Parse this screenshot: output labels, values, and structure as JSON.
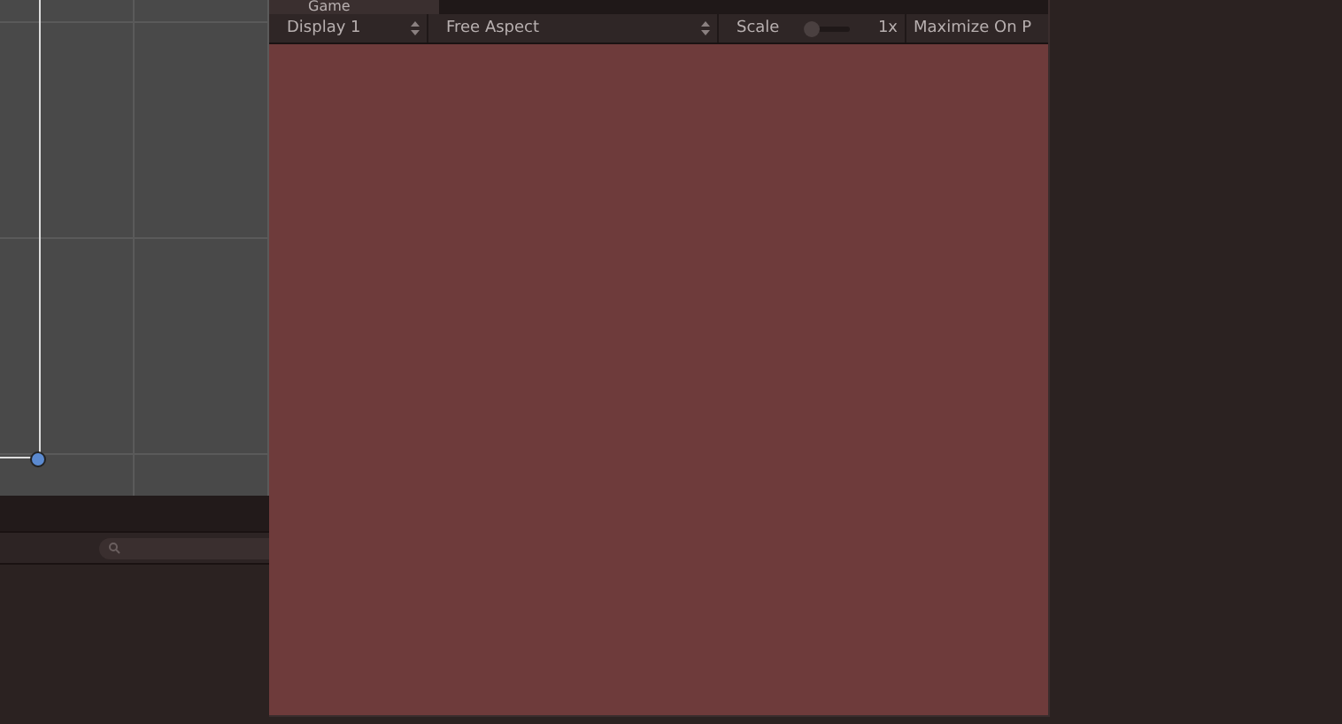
{
  "game_window": {
    "tab": {
      "label": "Game",
      "selected": true
    },
    "toolbar": {
      "display": "Display 1",
      "aspect": "Free Aspect",
      "scale": {
        "label": "Scale",
        "level": 0,
        "reading": "1x"
      },
      "maximize": "Maximize On P"
    }
  }
}
